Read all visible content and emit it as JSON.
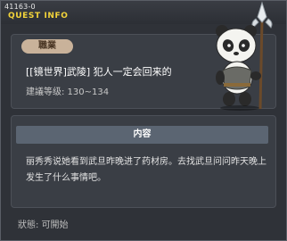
{
  "window": {
    "quest_id": "41163-0",
    "title": "QUEST INFO"
  },
  "quest": {
    "job_badge": "職業",
    "name": "[[镜世界]武陵] 犯人一定会回来的",
    "recommended_level": "建議等级: 130~134"
  },
  "content": {
    "header": "内容",
    "description": "丽秀秀说她看到武旦昨晚进了药材房。去找武旦问问昨天晚上发生了什么事情吧。"
  },
  "status": {
    "text": "狀態: 可開始"
  },
  "mascot": {
    "icon": "panda-spearman-icon"
  },
  "colors": {
    "title_accent": "#f3d43a",
    "badge_bg": "#c9b29a",
    "header_bg": "#5b6572"
  }
}
